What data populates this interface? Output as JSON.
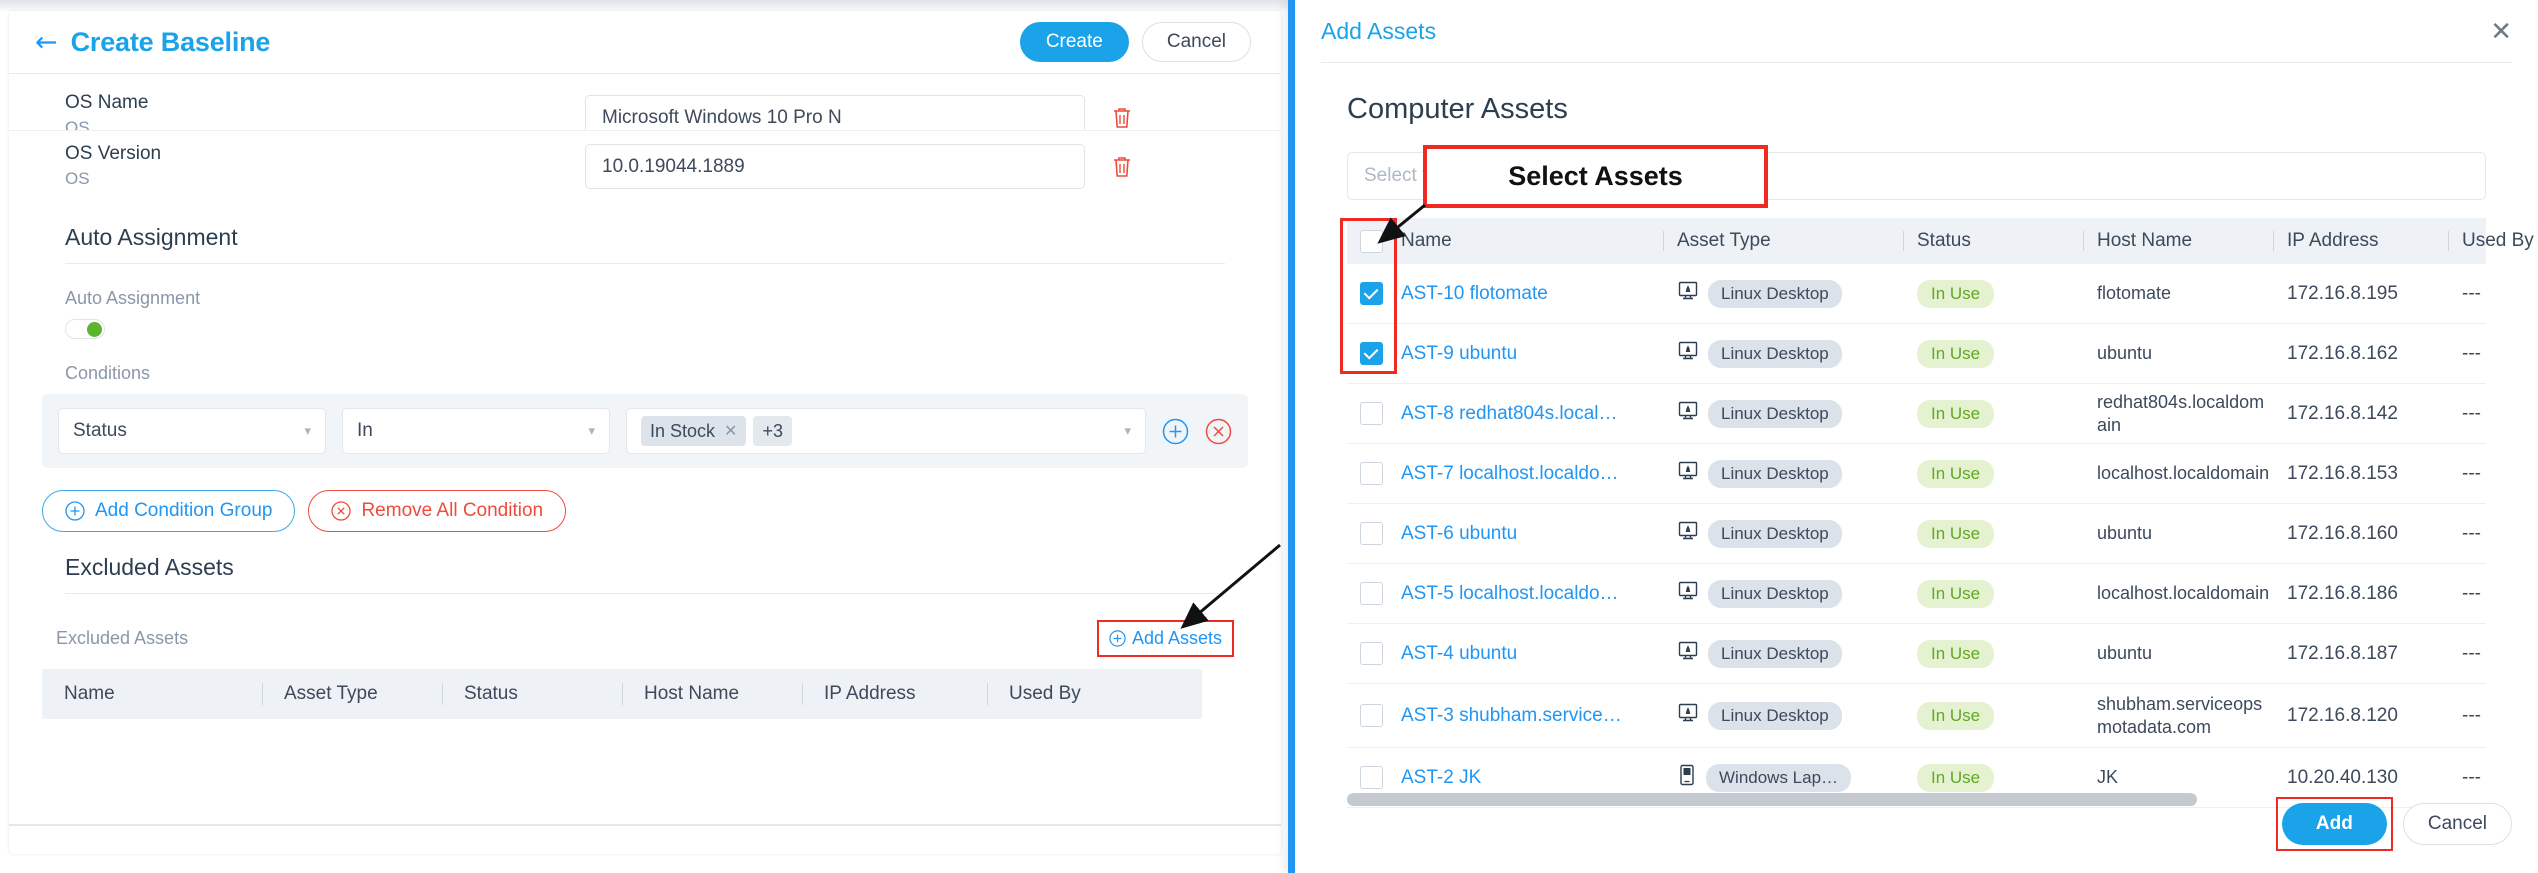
{
  "left_panel": {
    "back_icon": "arrow-left-icon",
    "title": "Create Baseline",
    "create_label": "Create",
    "cancel_label": "Cancel",
    "fields": [
      {
        "label": "OS Name",
        "sub": "OS",
        "value": "Microsoft Windows 10 Pro N",
        "delete_icon": "trash-icon"
      },
      {
        "label": "OS Version",
        "sub": "OS",
        "value": "10.0.19044.1889",
        "delete_icon": "trash-icon"
      }
    ],
    "auto_assignment": {
      "section_title": "Auto Assignment",
      "toggle_label": "Auto Assignment",
      "toggle_on": true,
      "conditions_label": "Conditions",
      "condition": {
        "field": "Status",
        "operator": "In",
        "values": [
          "In Stock"
        ],
        "more_count": "+3",
        "chip_remove_icon": "close-icon",
        "add_icon": "plus-circle-icon",
        "remove_icon": "close-circle-icon"
      },
      "add_condition_group_label": "Add Condition Group",
      "remove_all_condition_label": "Remove All Condition"
    },
    "excluded_assets": {
      "section_title": "Excluded Assets",
      "table_label": "Excluded Assets",
      "add_assets_label": "Add Assets",
      "add_assets_icon": "plus-circle-icon",
      "columns": [
        "Name",
        "Asset Type",
        "Status",
        "Host Name",
        "IP Address",
        "Used By"
      ],
      "rows": []
    }
  },
  "right_panel": {
    "title": "Add Assets",
    "close_icon": "close-icon",
    "section_title": "Computer Assets",
    "search_placeholder": "Select field",
    "search_value": "",
    "header_checkbox_checked": false,
    "columns": [
      "Name",
      "Asset Type",
      "Status",
      "Host Name",
      "IP Address",
      "Used By"
    ],
    "rows": [
      {
        "checked": true,
        "name": "AST-10 flotomate",
        "type": "Linux Desktop",
        "type_icon": "linux-desktop-icon",
        "status": "In Use",
        "host": "flotomate",
        "ip": "172.16.8.195",
        "used_by": "---"
      },
      {
        "checked": true,
        "name": "AST-9 ubuntu",
        "type": "Linux Desktop",
        "type_icon": "linux-desktop-icon",
        "status": "In Use",
        "host": "ubuntu",
        "ip": "172.16.8.162",
        "used_by": "---"
      },
      {
        "checked": false,
        "name": "AST-8 redhat804s.local…",
        "type": "Linux Desktop",
        "type_icon": "linux-desktop-icon",
        "status": "In Use",
        "host": "redhat804s.localdomain",
        "ip": "172.16.8.142",
        "used_by": "---"
      },
      {
        "checked": false,
        "name": "AST-7 localhost.localdo…",
        "type": "Linux Desktop",
        "type_icon": "linux-desktop-icon",
        "status": "In Use",
        "host": "localhost.localdomain",
        "ip": "172.16.8.153",
        "used_by": "---"
      },
      {
        "checked": false,
        "name": "AST-6 ubuntu",
        "type": "Linux Desktop",
        "type_icon": "linux-desktop-icon",
        "status": "In Use",
        "host": "ubuntu",
        "ip": "172.16.8.160",
        "used_by": "---"
      },
      {
        "checked": false,
        "name": "AST-5 localhost.localdo…",
        "type": "Linux Desktop",
        "type_icon": "linux-desktop-icon",
        "status": "In Use",
        "host": "localhost.localdomain",
        "ip": "172.16.8.186",
        "used_by": "---"
      },
      {
        "checked": false,
        "name": "AST-4 ubuntu",
        "type": "Linux Desktop",
        "type_icon": "linux-desktop-icon",
        "status": "In Use",
        "host": "ubuntu",
        "ip": "172.16.8.187",
        "used_by": "---"
      },
      {
        "checked": false,
        "name": "AST-3 shubham.service…",
        "type": "Linux Desktop",
        "type_icon": "linux-desktop-icon",
        "status": "In Use",
        "host": "shubham.serviceops motadata.com",
        "ip": "172.16.8.120",
        "used_by": "---"
      },
      {
        "checked": false,
        "name": "AST-2 JK",
        "type": "Windows Lap…",
        "type_icon": "windows-laptop-icon",
        "status": "In Use",
        "host": "JK",
        "ip": "10.20.40.130",
        "used_by": "---"
      }
    ],
    "add_label": "Add",
    "cancel_label": "Cancel"
  },
  "annotations": {
    "callout_text": "Select Assets",
    "highlight_color": "#ef2a22"
  },
  "colors": {
    "accent_blue": "#1aa3e8",
    "link_blue": "#2196f3",
    "danger_red": "#ef4b3c",
    "status_green": "#62a822",
    "status_green_bg": "#e4f2d2",
    "annotation_red": "#ef2a22"
  }
}
